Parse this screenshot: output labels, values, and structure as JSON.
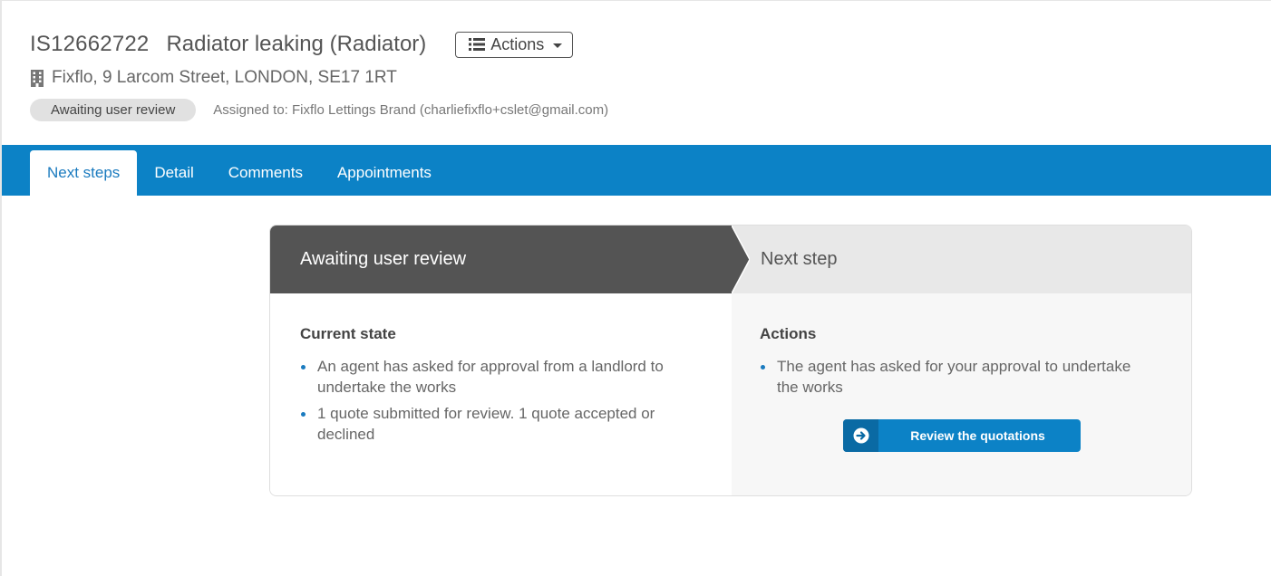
{
  "header": {
    "reference": "IS12662722",
    "title": "Radiator leaking (Radiator)",
    "actions_label": "Actions",
    "address": "Fixflo, 9 Larcom Street, LONDON, SE17 1RT",
    "status": "Awaiting user review",
    "assigned": "Assigned to: Fixflo Lettings Brand (charliefixflo+cslet@gmail.com)"
  },
  "tabs": [
    {
      "label": "Next steps",
      "active": true
    },
    {
      "label": "Detail",
      "active": false
    },
    {
      "label": "Comments",
      "active": false
    },
    {
      "label": "Appointments",
      "active": false
    }
  ],
  "card": {
    "left_heading": "Awaiting user review",
    "right_heading": "Next step",
    "current_state_title": "Current state",
    "current_state_items": [
      "An agent has asked for approval from a landlord to undertake the works",
      "1 quote submitted for review. 1 quote accepted or declined"
    ],
    "actions_title": "Actions",
    "actions_items": [
      "The agent has asked for your approval to undertake the works"
    ],
    "review_button_label": "Review the quotations"
  },
  "colors": {
    "accent": "#0c82c6",
    "dark_header": "#545454",
    "badge_bg": "#e1e1e1"
  },
  "icons": [
    "list-icon",
    "caret-down-icon",
    "building-icon",
    "arrow-circle-right-icon"
  ]
}
